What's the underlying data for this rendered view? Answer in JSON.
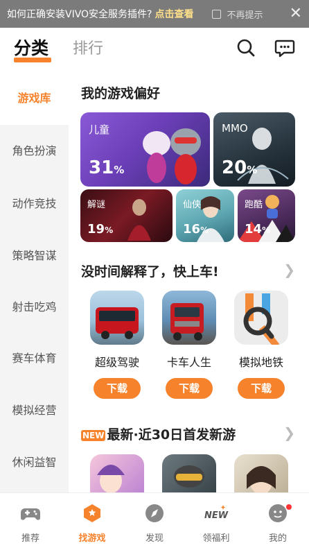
{
  "banner": {
    "question": "如何正确安装VIVO安全服务插件?",
    "link": "点击查看",
    "no_remind": "不再提示"
  },
  "header": {
    "tab_category": "分类",
    "tab_ranking": "排行"
  },
  "sidebar": {
    "items": [
      {
        "label": "游戏库"
      },
      {
        "label": "角色扮演"
      },
      {
        "label": "动作竞技"
      },
      {
        "label": "策略智谋"
      },
      {
        "label": "射击吃鸡"
      },
      {
        "label": "赛车体育"
      },
      {
        "label": "模拟经营"
      },
      {
        "label": "休闲益智"
      }
    ]
  },
  "preferences": {
    "title": "我的游戏偏好",
    "items": [
      {
        "label": "儿童",
        "value": "31",
        "unit": "%"
      },
      {
        "label": "MMO",
        "value": "20",
        "unit": "%"
      },
      {
        "label": "解谜",
        "value": "19",
        "unit": "%"
      },
      {
        "label": "仙侠",
        "value": "16",
        "unit": "%"
      },
      {
        "label": "跑酷",
        "value": "14",
        "unit": "%"
      }
    ]
  },
  "quick": {
    "title": "没时间解释了，快上车!",
    "games": [
      {
        "name": "超级驾驶",
        "button": "下载"
      },
      {
        "name": "卡车人生",
        "button": "下载"
      },
      {
        "name": "模拟地铁",
        "button": "下载"
      }
    ]
  },
  "newest": {
    "badge": "NEW",
    "title": "最新·近30日首发新游"
  },
  "bottom_nav": {
    "items": [
      {
        "label": "推荐"
      },
      {
        "label": "找游戏"
      },
      {
        "label": "发现"
      },
      {
        "label": "领福利"
      },
      {
        "label": "我的"
      }
    ]
  },
  "colors": {
    "accent": "#f6822c",
    "sidebar_bg": "#f4f4f4"
  }
}
